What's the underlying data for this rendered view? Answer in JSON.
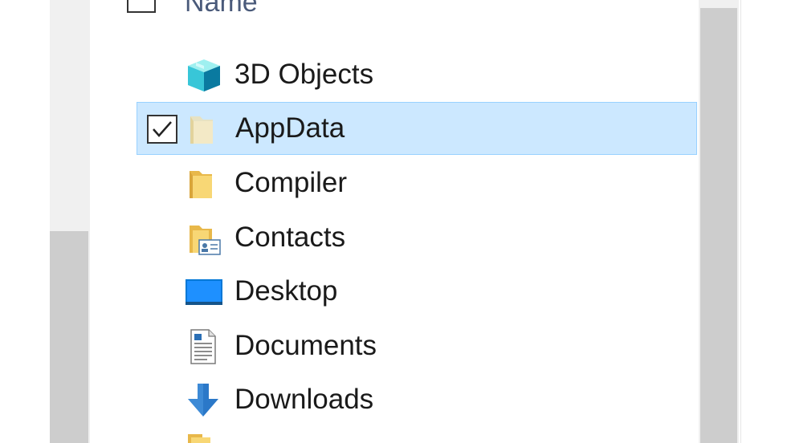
{
  "header": {
    "name_label": "Name"
  },
  "items": [
    {
      "label": "3D Objects",
      "icon": "3d-objects-icon",
      "selected": false
    },
    {
      "label": "AppData",
      "icon": "folder-hidden-icon",
      "selected": true
    },
    {
      "label": "Compiler",
      "icon": "folder-icon",
      "selected": false
    },
    {
      "label": "Contacts",
      "icon": "contacts-folder-icon",
      "selected": false
    },
    {
      "label": "Desktop",
      "icon": "desktop-icon",
      "selected": false
    },
    {
      "label": "Documents",
      "icon": "documents-icon",
      "selected": false
    },
    {
      "label": "Downloads",
      "icon": "downloads-icon",
      "selected": false
    }
  ],
  "colors": {
    "selection_bg": "#cce8ff",
    "selection_border": "#99d1ff",
    "folder": "#f8d775",
    "accent": "#0078d7"
  }
}
